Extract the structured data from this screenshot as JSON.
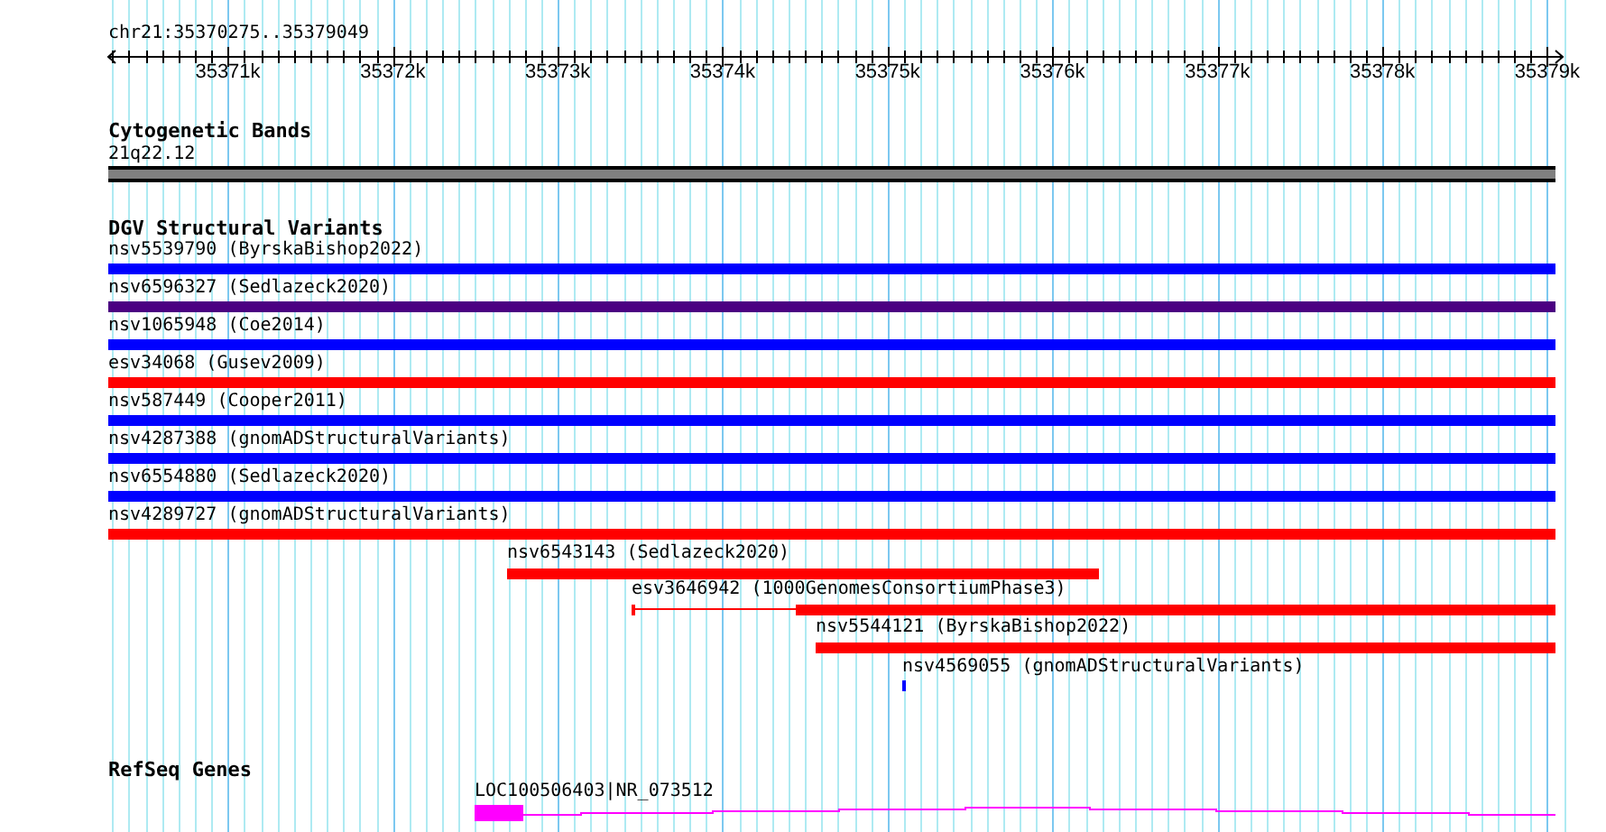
{
  "ruler": {
    "location": "chr21:35370275..35379049",
    "ticks": [
      "35371k",
      "35372k",
      "35373k",
      "35374k",
      "35375k",
      "35376k",
      "35377k",
      "35378k",
      "35379k"
    ]
  },
  "tracks": [
    {
      "kind": "bands",
      "title": "Cytogenetic Bands",
      "features": [
        {
          "label": "21q22.12",
          "color": "#808080"
        }
      ]
    },
    {
      "kind": "variants",
      "title": "DGV Structural Variants",
      "features": [
        {
          "label": "nsv5539790 (ByrskaBishop2022)",
          "color": "#0000ff"
        },
        {
          "label": "nsv6596327 (Sedlazeck2020)",
          "color": "#4b0082"
        },
        {
          "label": "nsv1065948 (Coe2014)",
          "color": "#0000ff"
        },
        {
          "label": "esv34068 (Gusev2009)",
          "color": "#ff0000"
        },
        {
          "label": "nsv587449 (Cooper2011)",
          "color": "#0000ff"
        },
        {
          "label": "nsv4287388 (gnomADStructuralVariants)",
          "color": "#0000ff"
        },
        {
          "label": "nsv6554880 (Sedlazeck2020)",
          "color": "#0000ff"
        },
        {
          "label": "nsv4289727 (gnomADStructuralVariants)",
          "color": "#ff0000"
        },
        {
          "label": "nsv6543143 (Sedlazeck2020)",
          "color": "#ff0000"
        },
        {
          "label": "esv3646942 (1000GenomesConsortiumPhase3)",
          "color": "#ff0000"
        },
        {
          "label": "nsv5544121 (ByrskaBishop2022)",
          "color": "#ff0000"
        },
        {
          "label": "nsv4569055 (gnomADStructuralVariants)",
          "color": "#0000ff"
        }
      ]
    },
    {
      "kind": "genes",
      "title": "RefSeq Genes",
      "features": [
        {
          "label": "LOC100506403|NR_073512",
          "color": "#ff00ff"
        }
      ]
    }
  ]
}
